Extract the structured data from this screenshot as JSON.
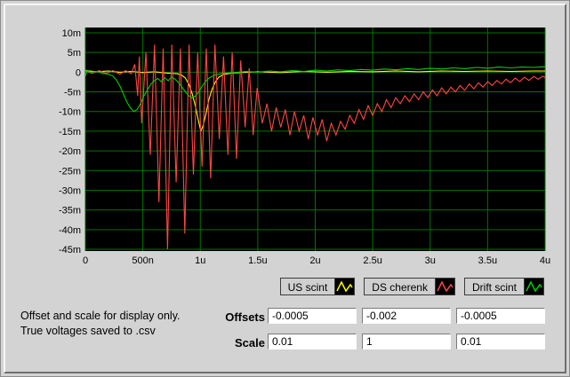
{
  "labels": {
    "offsets": "Offsets",
    "scale": "Scale"
  },
  "note": {
    "line1": "Offset and scale for display only.",
    "line2": "True voltages saved to .csv"
  },
  "legend": [
    {
      "label": "US scint",
      "color": "#ffff00"
    },
    {
      "label": "DS cherenk",
      "color": "#ff4545"
    },
    {
      "label": "Drift scint",
      "color": "#00d000"
    }
  ],
  "offsets": [
    "-0.0005",
    "-0.002",
    "-0.0005"
  ],
  "scale": [
    "0.01",
    "1",
    "0.01"
  ],
  "chart_data": {
    "type": "line",
    "title": "",
    "xlabel": "",
    "ylabel": "",
    "background": "#000000",
    "grid_color": "#007400",
    "grid": true,
    "legend_position": "below-right",
    "xlim_ns": [
      0,
      4000
    ],
    "ylim_mV": [
      -45,
      10
    ],
    "x_ticks": [
      {
        "ns": 0,
        "label": "0"
      },
      {
        "ns": 500,
        "label": "500n"
      },
      {
        "ns": 1000,
        "label": "1u"
      },
      {
        "ns": 1500,
        "label": "1.5u"
      },
      {
        "ns": 2000,
        "label": "2u"
      },
      {
        "ns": 2500,
        "label": "2.5u"
      },
      {
        "ns": 3000,
        "label": "3u"
      },
      {
        "ns": 3500,
        "label": "3.5u"
      },
      {
        "ns": 4000,
        "label": "4u"
      }
    ],
    "y_ticks": [
      {
        "mV": 10,
        "label": "10m"
      },
      {
        "mV": 5,
        "label": "5m"
      },
      {
        "mV": 0,
        "label": "0"
      },
      {
        "mV": -5,
        "label": "-5m"
      },
      {
        "mV": -10,
        "label": "-10m"
      },
      {
        "mV": -15,
        "label": "-15m"
      },
      {
        "mV": -20,
        "label": "-20m"
      },
      {
        "mV": -25,
        "label": "-25m"
      },
      {
        "mV": -30,
        "label": "-30m"
      },
      {
        "mV": -35,
        "label": "-35m"
      },
      {
        "mV": -40,
        "label": "-40m"
      },
      {
        "mV": -45,
        "label": "-45m"
      }
    ],
    "series": [
      {
        "name": "US scint",
        "color": "#ffff00",
        "points_ns_mV": [
          [
            0,
            0.4
          ],
          [
            100,
            0.1
          ],
          [
            200,
            0.3
          ],
          [
            300,
            0
          ],
          [
            400,
            0.2
          ],
          [
            500,
            -0.1
          ],
          [
            600,
            0.1
          ],
          [
            700,
            -0.2
          ],
          [
            800,
            -0.4
          ],
          [
            840,
            -0.8
          ],
          [
            870,
            -1.5
          ],
          [
            900,
            -3
          ],
          [
            930,
            -5.5
          ],
          [
            960,
            -9
          ],
          [
            985,
            -12.5
          ],
          [
            1005,
            -15
          ],
          [
            1025,
            -13.5
          ],
          [
            1050,
            -10.5
          ],
          [
            1075,
            -7
          ],
          [
            1100,
            -4.5
          ],
          [
            1130,
            -2.5
          ],
          [
            1160,
            -1.3
          ],
          [
            1200,
            -0.6
          ],
          [
            1260,
            -0.3
          ],
          [
            1350,
            -0.1
          ],
          [
            1500,
            0.1
          ],
          [
            1700,
            -0.1
          ],
          [
            1900,
            0.2
          ],
          [
            2100,
            0
          ],
          [
            2300,
            0.2
          ],
          [
            2500,
            0.1
          ],
          [
            2700,
            0.3
          ],
          [
            2900,
            0.1
          ],
          [
            3100,
            0.3
          ],
          [
            3300,
            0.2
          ],
          [
            3500,
            0.3
          ],
          [
            3700,
            0.2
          ],
          [
            3900,
            0.3
          ],
          [
            4000,
            0.3
          ]
        ]
      },
      {
        "name": "DS cherenk",
        "color": "#ff4545",
        "points_ns_mV": [
          [
            0,
            0.3
          ],
          [
            60,
            -0.3
          ],
          [
            120,
            0.4
          ],
          [
            180,
            -0.3
          ],
          [
            240,
            0.4
          ],
          [
            300,
            -0.5
          ],
          [
            350,
            0.4
          ],
          [
            400,
            -0.4
          ],
          [
            430,
            2
          ],
          [
            455,
            -6
          ],
          [
            470,
            4
          ],
          [
            490,
            -13
          ],
          [
            527,
            5
          ],
          [
            565,
            -21
          ],
          [
            602,
            7
          ],
          [
            640,
            -33
          ],
          [
            677,
            6
          ],
          [
            715,
            -45
          ],
          [
            752,
            7
          ],
          [
            790,
            -28
          ],
          [
            827,
            6
          ],
          [
            865,
            -41
          ],
          [
            902,
            7
          ],
          [
            940,
            -26
          ],
          [
            977,
            5
          ],
          [
            1015,
            -24
          ],
          [
            1052,
            6
          ],
          [
            1090,
            -27
          ],
          [
            1127,
            7
          ],
          [
            1165,
            -17
          ],
          [
            1202,
            4
          ],
          [
            1240,
            -21
          ],
          [
            1277,
            5
          ],
          [
            1315,
            -22
          ],
          [
            1352,
            3
          ],
          [
            1390,
            -14
          ],
          [
            1425,
            1
          ],
          [
            1460,
            -16
          ],
          [
            1495,
            -4
          ],
          [
            1540,
            -13
          ],
          [
            1580,
            -8
          ],
          [
            1620,
            -15
          ],
          [
            1660,
            -9
          ],
          [
            1700,
            -14
          ],
          [
            1740,
            -9.5
          ],
          [
            1780,
            -16
          ],
          [
            1820,
            -10
          ],
          [
            1860,
            -15
          ],
          [
            1900,
            -11
          ],
          [
            1940,
            -17
          ],
          [
            1980,
            -11.5
          ],
          [
            2020,
            -16
          ],
          [
            2060,
            -12
          ],
          [
            2100,
            -17.5
          ],
          [
            2140,
            -13
          ],
          [
            2180,
            -16
          ],
          [
            2220,
            -12.5
          ],
          [
            2260,
            -14.5
          ],
          [
            2300,
            -11
          ],
          [
            2340,
            -13
          ],
          [
            2380,
            -9.5
          ],
          [
            2420,
            -12
          ],
          [
            2460,
            -8.5
          ],
          [
            2500,
            -11
          ],
          [
            2540,
            -8
          ],
          [
            2580,
            -10
          ],
          [
            2620,
            -7
          ],
          [
            2660,
            -9
          ],
          [
            2700,
            -6.5
          ],
          [
            2740,
            -8
          ],
          [
            2780,
            -6
          ],
          [
            2820,
            -7.5
          ],
          [
            2860,
            -5.5
          ],
          [
            2900,
            -7
          ],
          [
            2940,
            -5
          ],
          [
            2980,
            -6.5
          ],
          [
            3020,
            -4.5
          ],
          [
            3060,
            -6
          ],
          [
            3100,
            -4
          ],
          [
            3140,
            -5.5
          ],
          [
            3180,
            -3.8
          ],
          [
            3220,
            -5
          ],
          [
            3260,
            -3.4
          ],
          [
            3300,
            -4.6
          ],
          [
            3340,
            -3
          ],
          [
            3380,
            -4.2
          ],
          [
            3420,
            -2.7
          ],
          [
            3460,
            -3.8
          ],
          [
            3500,
            -2.4
          ],
          [
            3540,
            -3.4
          ],
          [
            3580,
            -2.1
          ],
          [
            3620,
            -3
          ],
          [
            3660,
            -1.8
          ],
          [
            3700,
            -2.7
          ],
          [
            3740,
            -1.5
          ],
          [
            3780,
            -2.4
          ],
          [
            3820,
            -1.3
          ],
          [
            3860,
            -2.1
          ],
          [
            3900,
            -1.1
          ],
          [
            3940,
            -1.8
          ],
          [
            3980,
            -1
          ],
          [
            4000,
            -1.4
          ]
        ]
      },
      {
        "name": "Drift scint",
        "color": "#00d000",
        "points_ns_mV": [
          [
            0,
            -1
          ],
          [
            15,
            0.5
          ],
          [
            40,
            0
          ],
          [
            100,
            0.2
          ],
          [
            150,
            -0.3
          ],
          [
            200,
            -0.5
          ],
          [
            240,
            -1
          ],
          [
            270,
            -2
          ],
          [
            300,
            -3.5
          ],
          [
            330,
            -5.5
          ],
          [
            360,
            -7.5
          ],
          [
            390,
            -9
          ],
          [
            420,
            -10
          ],
          [
            450,
            -9.5
          ],
          [
            480,
            -8
          ],
          [
            510,
            -6
          ],
          [
            540,
            -4.5
          ],
          [
            570,
            -3
          ],
          [
            600,
            -2.2
          ],
          [
            630,
            -1.6
          ],
          [
            660,
            -2.4
          ],
          [
            690,
            -1.4
          ],
          [
            720,
            -2.2
          ],
          [
            750,
            -1.2
          ],
          [
            780,
            -1.8
          ],
          [
            810,
            -2.6
          ],
          [
            840,
            -3.8
          ],
          [
            870,
            -5
          ],
          [
            900,
            -6
          ],
          [
            930,
            -6.6
          ],
          [
            960,
            -6
          ],
          [
            990,
            -4.8
          ],
          [
            1020,
            -3.4
          ],
          [
            1050,
            -2.2
          ],
          [
            1080,
            -1.4
          ],
          [
            1120,
            -0.8
          ],
          [
            1160,
            -0.5
          ],
          [
            1200,
            -0.3
          ],
          [
            1300,
            -0.1
          ],
          [
            1400,
            0.2
          ],
          [
            1500,
            0
          ],
          [
            1600,
            0.3
          ],
          [
            1700,
            0.1
          ],
          [
            1800,
            0.4
          ],
          [
            1900,
            0.2
          ],
          [
            2000,
            0.5
          ],
          [
            2100,
            0.3
          ],
          [
            2200,
            0.6
          ],
          [
            2300,
            0.4
          ],
          [
            2400,
            0.7
          ],
          [
            2500,
            0.5
          ],
          [
            2600,
            0.8
          ],
          [
            2700,
            0.6
          ],
          [
            2800,
            0.9
          ],
          [
            2900,
            0.7
          ],
          [
            3000,
            1
          ],
          [
            3100,
            0.8
          ],
          [
            3200,
            1.1
          ],
          [
            3300,
            0.9
          ],
          [
            3400,
            1.2
          ],
          [
            3500,
            1
          ],
          [
            3600,
            1.3
          ],
          [
            3700,
            1.1
          ],
          [
            3800,
            1.3
          ],
          [
            3900,
            1.2
          ],
          [
            4000,
            1.4
          ]
        ]
      }
    ]
  }
}
